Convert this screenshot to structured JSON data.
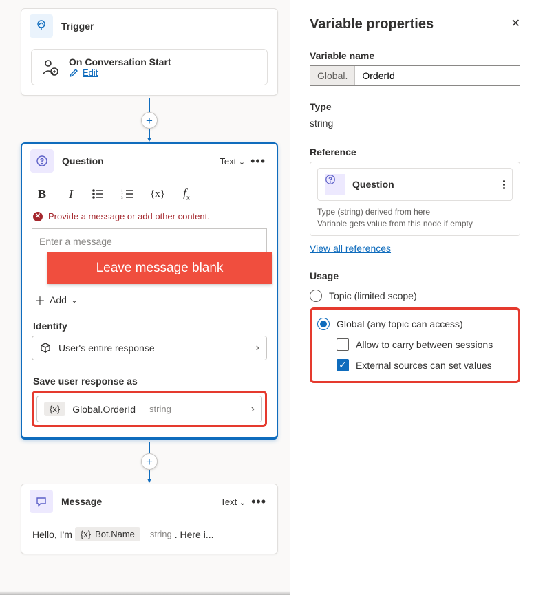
{
  "canvas": {
    "trigger": {
      "title": "Trigger",
      "sub_title": "On Conversation Start",
      "edit_label": "Edit"
    },
    "question": {
      "title": "Question",
      "type_label": "Text",
      "error": "Provide a message or add other content.",
      "placeholder": "Enter a message",
      "add_label": "Add",
      "identify_label": "Identify",
      "identify_value": "User's entire response",
      "save_label": "Save user response as",
      "save_var_name": "Global.OrderId",
      "save_var_type": "string"
    },
    "message": {
      "title": "Message",
      "type_label": "Text",
      "text_prefix": "Hello, I'm",
      "bot_var": "Bot.Name",
      "bot_var_type": "string",
      "text_suffix": ". Here i..."
    }
  },
  "annotation": {
    "text": "Leave message blank"
  },
  "panel": {
    "title": "Variable properties",
    "name_label": "Variable name",
    "name_prefix": "Global.",
    "name_value": "OrderId",
    "type_label": "Type",
    "type_value": "string",
    "reference_label": "Reference",
    "reference_card_title": "Question",
    "reference_sub1": "Type (string) derived from here",
    "reference_sub2": "Variable gets value from this node if empty",
    "view_all_link": "View all references",
    "usage_label": "Usage",
    "usage_topic": "Topic (limited scope)",
    "usage_global": "Global (any topic can access)",
    "usage_carry": "Allow to carry between sessions",
    "usage_external": "External sources can set values"
  }
}
